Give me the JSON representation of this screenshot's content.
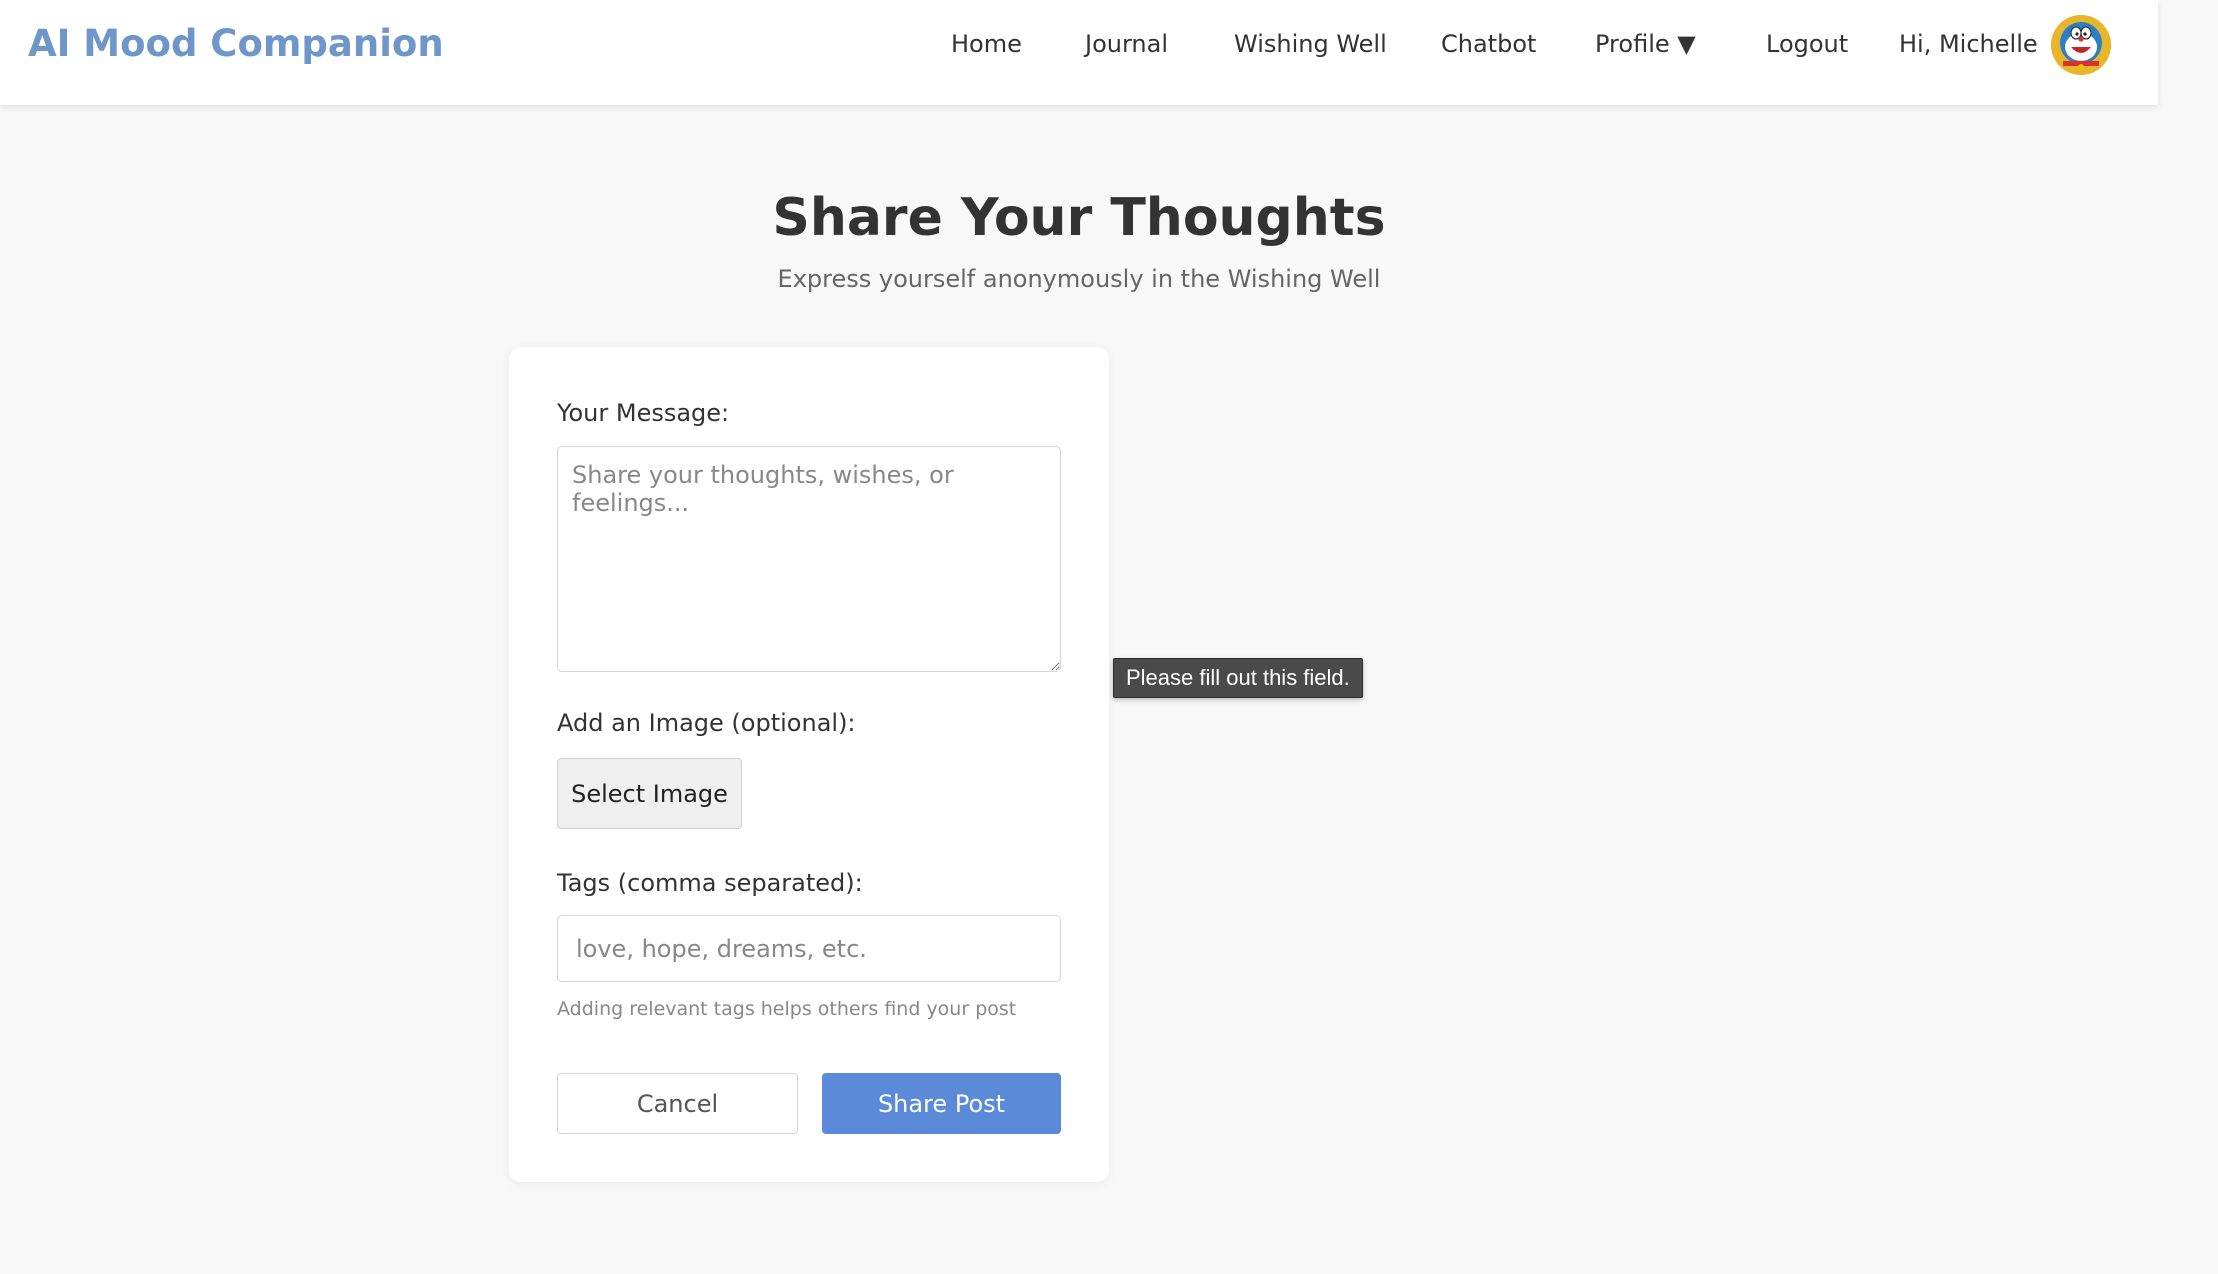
{
  "navbar": {
    "brand": "AI Mood Companion",
    "links": {
      "home": "Home",
      "journal": "Journal",
      "wishing_well": "Wishing Well",
      "chatbot": "Chatbot",
      "profile": "Profile ▼",
      "logout": "Logout"
    },
    "greeting": "Hi, Michelle",
    "avatar_icon": "doraemon-avatar-icon"
  },
  "page": {
    "title": "Share Your Thoughts",
    "subtitle": "Express yourself anonymously in the Wishing Well"
  },
  "form": {
    "message_label": "Your Message:",
    "message_placeholder": "Share your thoughts, wishes, or feelings...",
    "message_value": "",
    "image_label": "Add an Image (optional):",
    "select_image_label": "Select Image",
    "tags_label": "Tags (comma separated):",
    "tags_placeholder": "love, hope, dreams, etc.",
    "tags_value": "",
    "tags_hint": "Adding relevant tags helps others find your post",
    "cancel_label": "Cancel",
    "share_label": "Share Post"
  },
  "validation_tooltip": "Please fill out this field.",
  "colors": {
    "brand": "#6f96c8",
    "primary_button": "#5b8ad9",
    "background": "#f8f8f8"
  }
}
